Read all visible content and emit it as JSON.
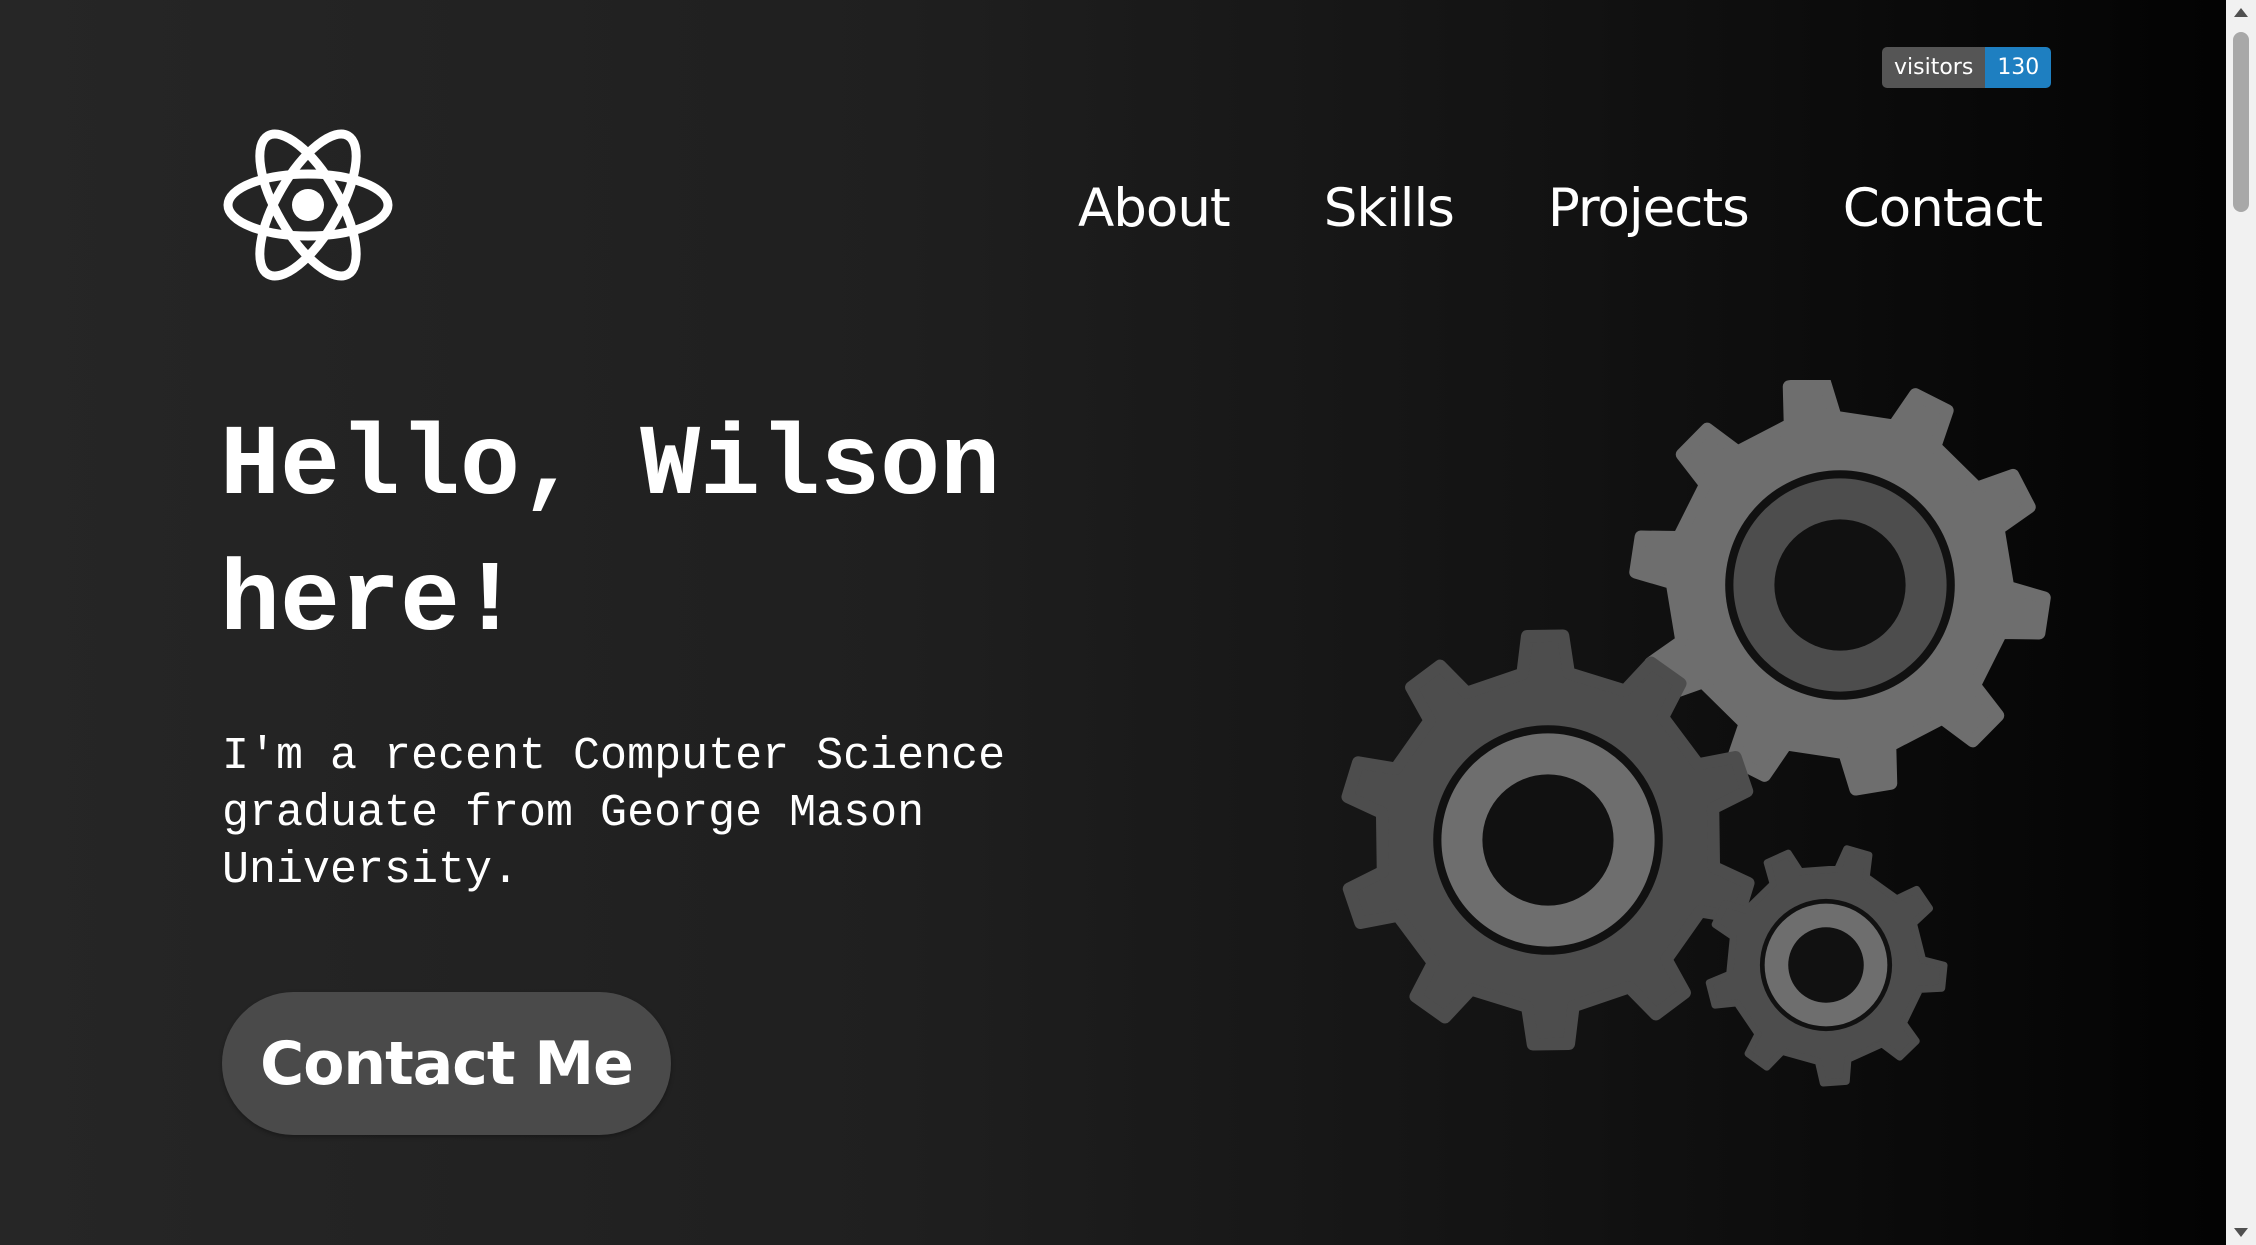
{
  "badge": {
    "label": "visitors",
    "count": "130"
  },
  "logo": {
    "icon": "atom-icon"
  },
  "nav": {
    "items": [
      {
        "label": "About"
      },
      {
        "label": "Skills"
      },
      {
        "label": "Projects"
      },
      {
        "label": "Contact"
      }
    ]
  },
  "hero": {
    "title_line1": "Hello, Wilson",
    "title_line2": "here!",
    "subtitle": "I'm a recent Computer Science graduate from George Mason University.",
    "cta_label": "Contact Me",
    "illustration": "gears-icon"
  },
  "colors": {
    "badge_label_bg": "#555555",
    "badge_count_bg": "#1e7fc1",
    "button_bg": "#4a4a4a",
    "text": "#ffffff",
    "gear_light": "#6e6e6e",
    "gear_dark": "#4d4d4d"
  }
}
